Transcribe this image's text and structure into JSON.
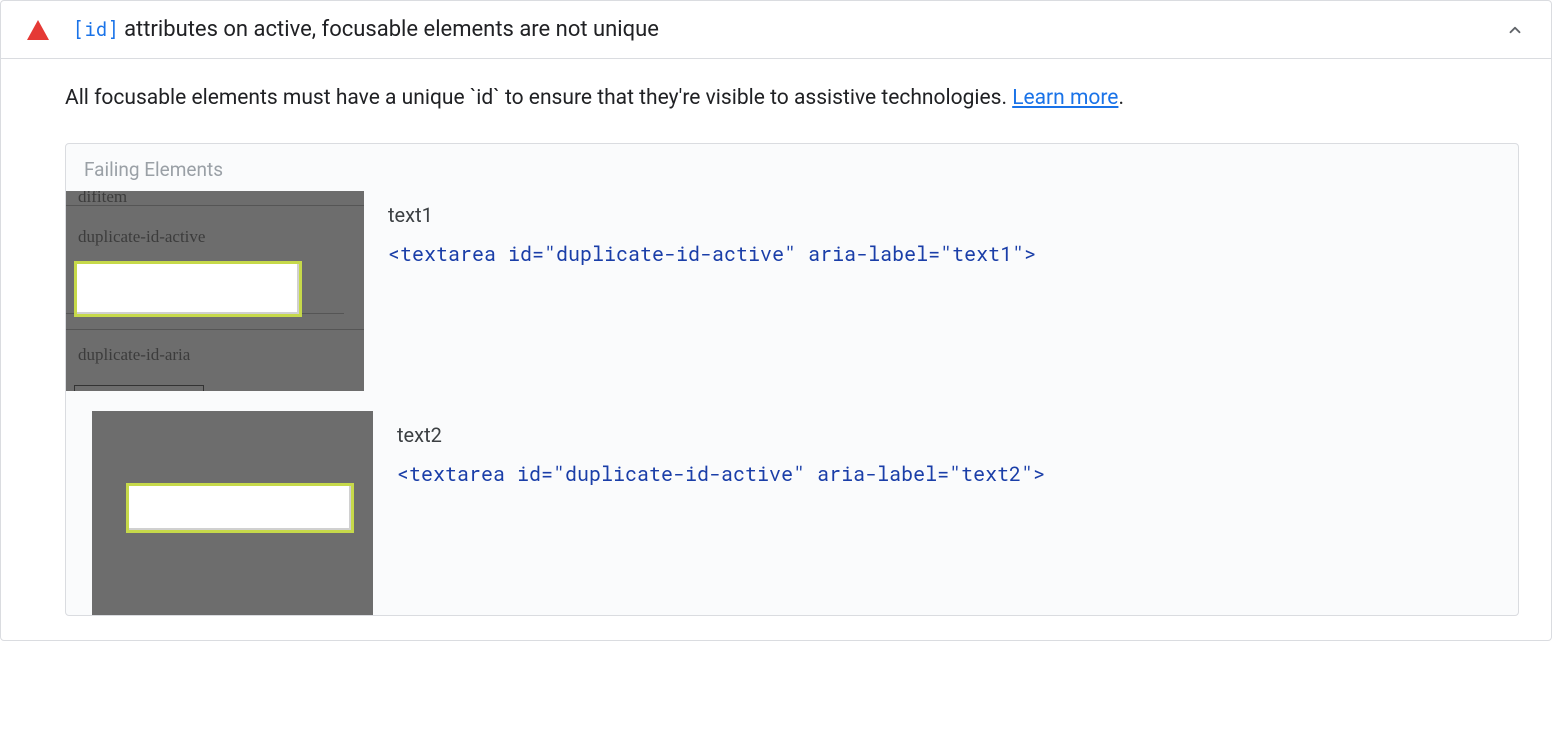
{
  "audit": {
    "code_label": "[id]",
    "title_suffix": " attributes on active, focusable elements are not unique",
    "description_prefix": "All focusable elements must have a unique `id` to ensure that they're visible to assistive technologies. ",
    "learn_more": "Learn more",
    "failing_header": "Failing Elements",
    "items": [
      {
        "label": "text1",
        "code": "<textarea id=\"duplicate-id-active\" aria-label=\"text1\">",
        "thumb_text_cut": "difitem",
        "thumb_text1": "duplicate-id-active",
        "thumb_text2": "duplicate-id-aria"
      },
      {
        "label": "text2",
        "code": "<textarea id=\"duplicate-id-active\" aria-label=\"text2\">"
      }
    ]
  }
}
